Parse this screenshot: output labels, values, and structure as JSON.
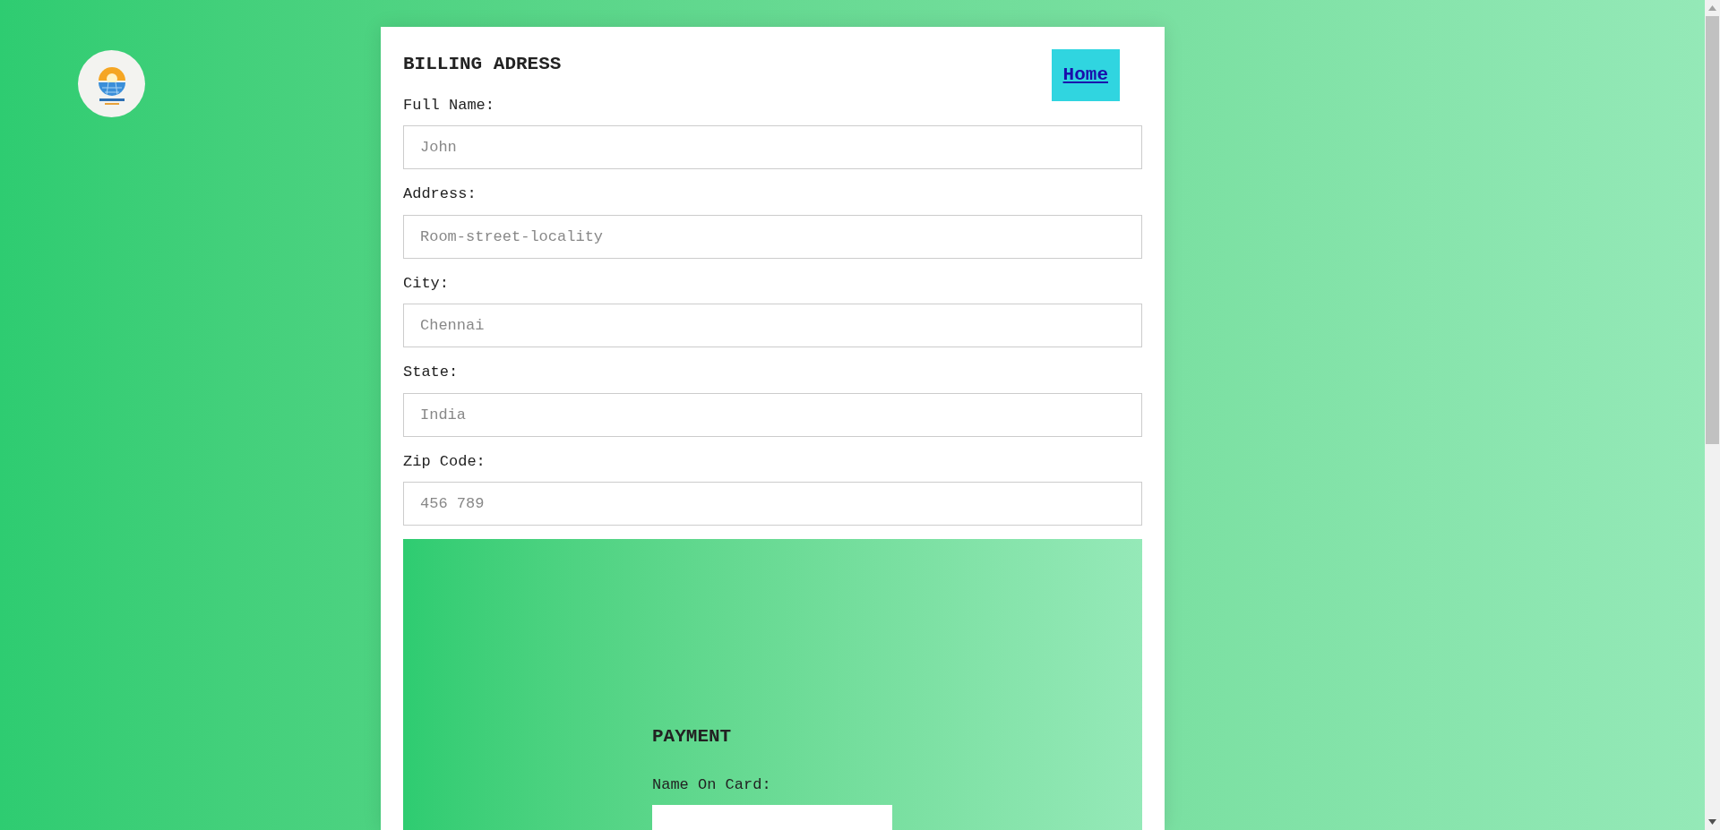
{
  "billing": {
    "title": "BILLING ADRESS",
    "home_link": "Home",
    "fields": [
      {
        "label": "Full Name:",
        "placeholder": "John"
      },
      {
        "label": "Address:",
        "placeholder": "Room-street-locality"
      },
      {
        "label": "City:",
        "placeholder": "Chennai"
      },
      {
        "label": "State:",
        "placeholder": "India"
      },
      {
        "label": "Zip Code:",
        "placeholder": "456 789"
      }
    ]
  },
  "payment": {
    "title": "PAYMENT",
    "fields": [
      {
        "label": "Name On Card:"
      }
    ]
  }
}
